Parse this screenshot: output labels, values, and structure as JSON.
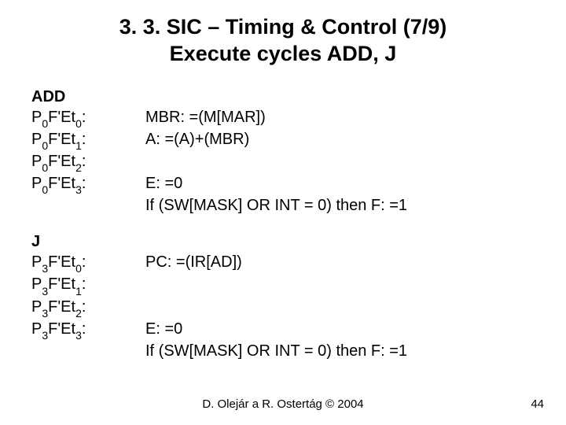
{
  "title_line1": "3. 3. SIC – Timing & Control (7/9)",
  "title_line2": "Execute cycles ADD, J",
  "add": {
    "heading": "ADD",
    "rows": [
      {
        "p": "0",
        "t": "0",
        "val": "MBR: =(M[MAR])"
      },
      {
        "p": "0",
        "t": "1",
        "val": "A: =(A)+(MBR)"
      },
      {
        "p": "0",
        "t": "2",
        "val": ""
      },
      {
        "p": "0",
        "t": "3",
        "val": "E: =0"
      }
    ],
    "tail": "If (SW[MASK] OR INT = 0) then F: =1"
  },
  "j": {
    "heading": "J",
    "rows": [
      {
        "p": "3",
        "t": "0",
        "val": "PC: =(IR[AD])"
      },
      {
        "p": "3",
        "t": "1",
        "val": ""
      },
      {
        "p": "3",
        "t": "2",
        "val": ""
      },
      {
        "p": "3",
        "t": "3",
        "val": "E: =0"
      }
    ],
    "tail": "If (SW[MASK] OR INT = 0) then F: =1"
  },
  "footer": "D. Olejár a R. Ostertág © 2004",
  "page": "44"
}
